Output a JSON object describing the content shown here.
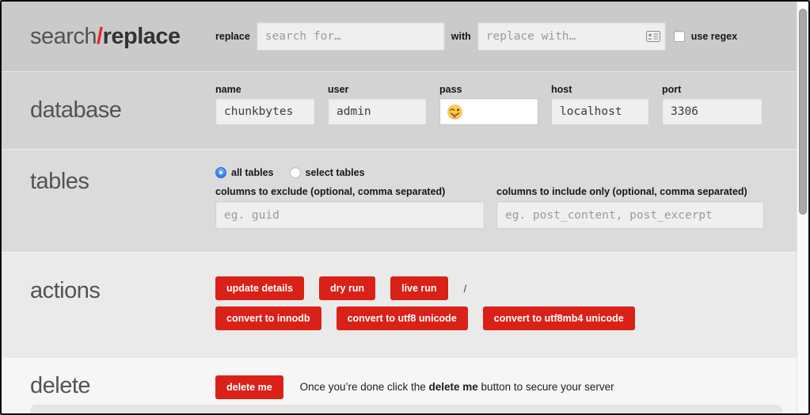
{
  "colors": {
    "accent_red": "#d92118",
    "radio_blue": "#2e7df2",
    "title_slash_red": "#e12d22"
  },
  "search_replace": {
    "title_search": "search",
    "title_slash": "/",
    "title_replace": "replace",
    "replace_label": "replace",
    "search_placeholder": "search for…",
    "with_label": "with",
    "replace_with_placeholder": "replace with…",
    "use_regex_label": "use regex"
  },
  "database": {
    "title": "database",
    "name_label": "name",
    "name_value": "chunkbytes",
    "user_label": "user",
    "user_value": "admin",
    "pass_label": "pass",
    "pass_value": "",
    "host_label": "host",
    "host_value": "localhost",
    "port_label": "port",
    "port_value": "3306"
  },
  "tables": {
    "title": "tables",
    "all_tables_label": "all tables",
    "select_tables_label": "select tables",
    "exclude_label": "columns to exclude (optional, comma separated)",
    "exclude_placeholder": "eg. guid",
    "include_label": "columns to include only (optional, comma separated)",
    "include_placeholder": "eg. post_content, post_excerpt"
  },
  "actions": {
    "title": "actions",
    "update_details": "update details",
    "dry_run": "dry run",
    "live_run": "live run",
    "separator": "/",
    "convert_innodb": "convert to innodb",
    "convert_utf8": "convert to utf8 unicode",
    "convert_utf8mb4": "convert to utf8mb4 unicode"
  },
  "delete": {
    "title": "delete",
    "button": "delete me",
    "note_prefix": "Once you’re done click the ",
    "note_bold": "delete me",
    "note_suffix": " button to secure your server"
  },
  "icons": {
    "autofill": "contact-card autofill glyph",
    "pass_emoji": "winking face with tongue emoji"
  }
}
